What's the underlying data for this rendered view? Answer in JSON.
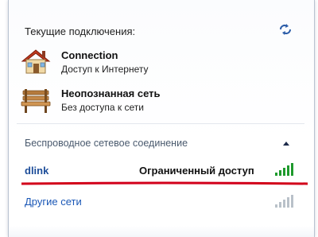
{
  "current": {
    "title": "Текущие подключения:",
    "items": [
      {
        "name": "Connection",
        "status": "Доступ к Интернету",
        "icon": "house-network-icon"
      },
      {
        "name": "Неопознанная сеть",
        "status": "Без доступа к сети",
        "icon": "bench-network-icon"
      }
    ]
  },
  "wireless": {
    "title": "Беспроводное сетевое соединение",
    "networks": [
      {
        "name": "dlink",
        "status": "Ограниченный доступ",
        "signal": 5,
        "color": "#1d4d99"
      },
      {
        "name": "Другие сети",
        "status": "",
        "signal": 5,
        "color": "#1a57b6"
      }
    ]
  },
  "colors": {
    "signal_active": "#1f9a2d",
    "signal_inactive": "#b9c1c9",
    "annotation": "#d2001a"
  }
}
